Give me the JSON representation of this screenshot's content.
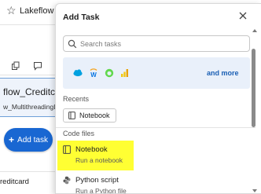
{
  "background": {
    "window_title": "Lakeflow Jo",
    "task_name": "flow_Creditcard",
    "task_subtitle": "w_MultithreadingLo",
    "add_task_label": "Add task",
    "bottom_text": "reditcard"
  },
  "modal": {
    "title": "Add Task",
    "search": {
      "placeholder": "Search tasks",
      "value": ""
    },
    "integrations": {
      "icons": [
        "salesforce-icon",
        "workday-icon",
        "servicenow-icon",
        "power-bi-icon"
      ],
      "more_label": "and more"
    },
    "recents": {
      "label": "Recents",
      "items": [
        {
          "label": "Notebook",
          "icon": "notebook-icon"
        }
      ]
    },
    "code_files": {
      "label": "Code files",
      "items": [
        {
          "title": "Notebook",
          "subtitle": "Run a notebook",
          "icon": "notebook-icon",
          "highlighted": true
        },
        {
          "title": "Python script",
          "subtitle": "Run a Python file",
          "icon": "python-icon",
          "highlighted": false
        }
      ]
    }
  },
  "colors": {
    "accent": "#1967d2",
    "highlight": "#ffff33",
    "integrations_bg": "#e9f0fa",
    "link": "#1a5fb4"
  }
}
